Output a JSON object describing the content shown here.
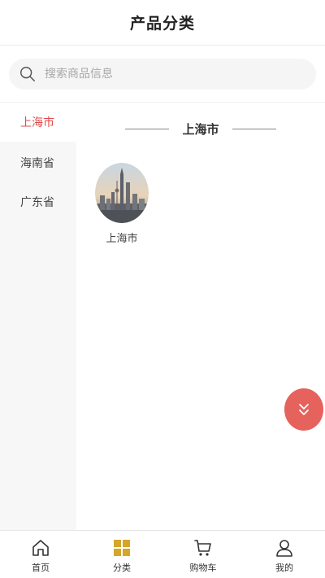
{
  "header": {
    "title": "产品分类"
  },
  "search": {
    "placeholder": "搜索商品信息"
  },
  "sidebar": {
    "items": [
      {
        "label": "上海市",
        "active": true
      },
      {
        "label": "海南省",
        "active": false
      },
      {
        "label": "广东省",
        "active": false
      }
    ]
  },
  "content": {
    "section_title": "上海市",
    "cities": [
      {
        "label": "上海市",
        "image": "shanghai-skyline-image"
      }
    ]
  },
  "scroll_button": {
    "icon": "double-chevron-down-icon",
    "color": "#e6625c"
  },
  "tabbar": {
    "items": [
      {
        "label": "首页",
        "icon": "home-icon",
        "active": false
      },
      {
        "label": "分类",
        "icon": "category-grid-icon",
        "active": true
      },
      {
        "label": "购物车",
        "icon": "cart-icon",
        "active": false
      },
      {
        "label": "我的",
        "icon": "user-icon",
        "active": false
      }
    ]
  },
  "colors": {
    "accent_red": "#e04a4a",
    "category_gold": "#d4a62a",
    "sidebar_bg": "#f7f7f7"
  }
}
